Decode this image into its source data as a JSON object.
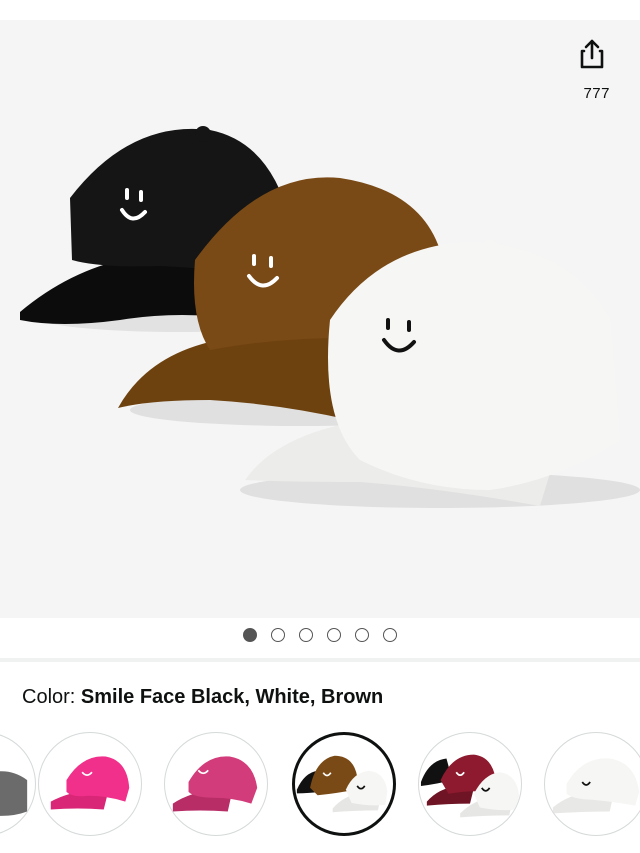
{
  "share": {
    "icon": "share-icon",
    "count": "777"
  },
  "gallery": {
    "dot_count": 6,
    "active_index": 0,
    "hero_colors": {
      "black": "#111111",
      "brown": "#7a4a16",
      "white": "#f4f4f2"
    }
  },
  "color_selector": {
    "prefix": "Color: ",
    "selected": "Smile Face Black, White, Brown"
  },
  "swatches": [
    {
      "name": "partial-gray",
      "colors": [
        "#6b6b6b"
      ]
    },
    {
      "name": "hot-pink",
      "colors": [
        "#f0308a"
      ]
    },
    {
      "name": "rose-pink",
      "colors": [
        "#d23c7a"
      ]
    },
    {
      "name": "black-white-brown",
      "colors": [
        "#111111",
        "#7a4a16",
        "#f4f4f2"
      ]
    },
    {
      "name": "black-burgundy-white",
      "colors": [
        "#111111",
        "#8d1a2e",
        "#f4f4f2"
      ]
    },
    {
      "name": "white",
      "colors": [
        "#f4f4f2"
      ]
    }
  ]
}
